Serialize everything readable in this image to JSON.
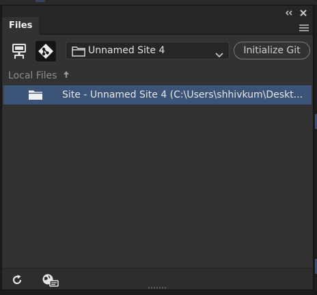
{
  "panel": {
    "tab_label": "Files"
  },
  "toolbar": {
    "site_selector_value": "Unnamed Site 4",
    "initialize_git_label": "Initialize Git"
  },
  "local_files": {
    "header_label": "Local Files"
  },
  "tree": {
    "rows": [
      {
        "label": "Site - Unnamed Site 4 (C:\\Users\\shhivkum\\Deskt..."
      }
    ]
  },
  "icons": {
    "collapse": "double-chevron-icon",
    "close": "close-icon",
    "panel_menu": "hamburger-icon",
    "manage_sites": "computer-network-icon",
    "git": "git-diamond-icon",
    "site_folder": "folder-icon",
    "dropdown": "chevron-down-icon",
    "sort": "up-arrow-icon",
    "row_folder": "folder-icon",
    "refresh": "refresh-icon",
    "log": "globe-chat-icon"
  },
  "colors": {
    "panel_bg": "#323232",
    "selection": "#3b5478",
    "tab_text": "#f2f2f2"
  }
}
